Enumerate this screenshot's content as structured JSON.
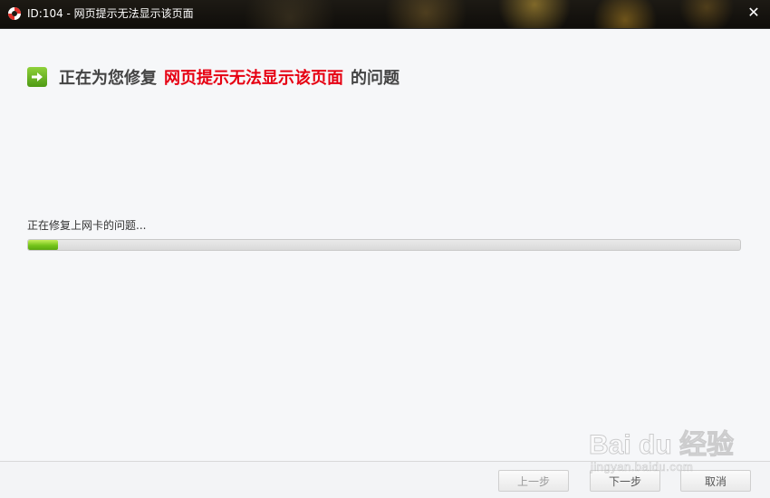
{
  "window": {
    "title": "ID:104 - 网页提示无法显示该页面",
    "close_glyph": "✕"
  },
  "heading": {
    "prefix": "正在为您修复",
    "issue": "网页提示无法显示该页面",
    "suffix": "的问题",
    "icon": "green-arrow-right-icon"
  },
  "progress": {
    "status_text": "正在修复上网卡的问题...",
    "value": 0.042
  },
  "footer": {
    "prev_label": "上一步",
    "next_label": "下一步",
    "cancel_label": "取消",
    "prev_enabled": false
  },
  "watermark": {
    "brand": "Bai du 经验",
    "url": "jingyan.baidu.com"
  },
  "colors": {
    "issue_red": "#e60012",
    "progress_green": "#75c51b",
    "window_bg": "#f6f7f9"
  }
}
